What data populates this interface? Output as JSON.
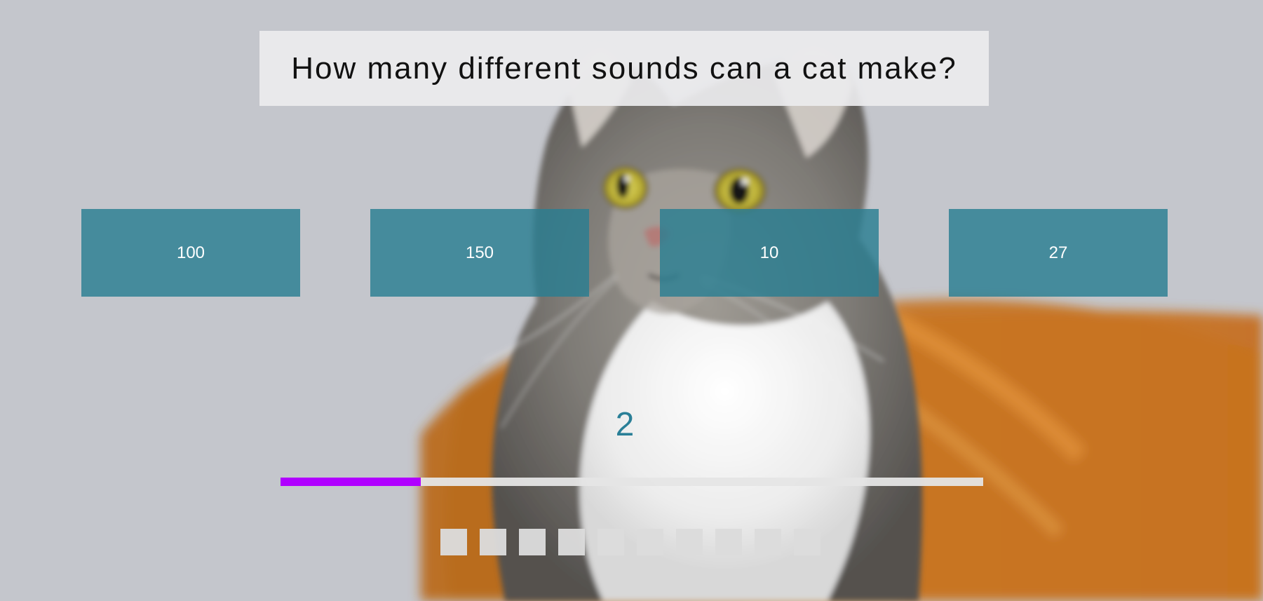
{
  "quiz": {
    "question": "How many different sounds can a cat make?",
    "answers": [
      "100",
      "150",
      "10",
      "27"
    ],
    "timer_value": "2",
    "progress_percent": 20,
    "question_count": 10,
    "colors": {
      "answer_button": "#297E91",
      "timer_text": "#2A7F97",
      "progress_fill": "#B000FF",
      "progress_track": "#E5E5E5",
      "question_box": "#ECECEE"
    }
  }
}
